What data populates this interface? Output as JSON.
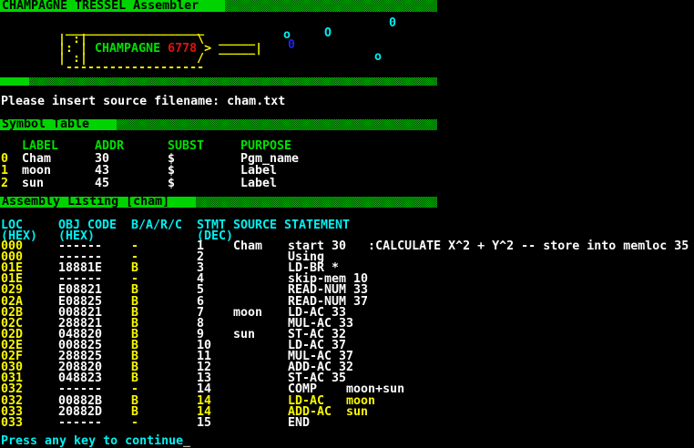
{
  "title_bar": {
    "text": "CHAMPAGNE TRESSEL Assembler"
  },
  "bottle": {
    "top": " ___________________",
    "row2": "| :|               \\  _____",
    "row3_pre": "|: | ",
    "label": "CHAMPAGNE",
    "row3_mid": " ",
    "number": "6778",
    "row3_post": " > _____|",
    "row4": "| :|               /",
    "bottom": " -------------------",
    "bubbles": [
      {
        "glyph": "o",
        "color": "#00f0f0"
      },
      {
        "glyph": "0",
        "color": "#2222e8"
      },
      {
        "glyph": "O",
        "color": "#00f0f0"
      },
      {
        "glyph": "0",
        "color": "#00f0f0"
      },
      {
        "glyph": "o",
        "color": "#00f0f0"
      }
    ]
  },
  "prompt": {
    "text": "Please insert source filename: cham.txt"
  },
  "symbol_table": {
    "bar_label": "Symbol Table",
    "headers": [
      "LABEL",
      "ADDR",
      "SUBST",
      "PURPOSE"
    ],
    "rows": [
      {
        "index": "0",
        "label": "Cham",
        "addr": "30",
        "subst": "$",
        "purpose": "Pgm_name"
      },
      {
        "index": "1",
        "label": "moon",
        "addr": "43",
        "subst": "$",
        "purpose": "Label"
      },
      {
        "index": "2",
        "label": "sun",
        "addr": "45",
        "subst": "$",
        "purpose": "Label"
      }
    ]
  },
  "listing": {
    "bar_label": "Assembly Listing [cham]",
    "headers": {
      "loc": "LOC",
      "obj": "OBJ CODE",
      "barc": "B/A/R/C",
      "stmt": "STMT",
      "source": "SOURCE",
      "statement": "STATEMENT",
      "loc_unit": "(HEX)",
      "obj_unit": "(HEX)",
      "stmt_unit": "(DEC)"
    },
    "rows": [
      {
        "loc": "000",
        "obj": "------",
        "barc": "-",
        "stmt": "1",
        "src": "Cham",
        "st": "start 30   :CALCULATE X^2 + Y^2 -- store into memloc 35"
      },
      {
        "loc": "000",
        "obj": "------",
        "barc": "-",
        "stmt": "2",
        "src": "",
        "st": "Using"
      },
      {
        "loc": "01E",
        "obj": "18881E",
        "barc": "B",
        "stmt": "3",
        "src": "",
        "st": "LD-BR *"
      },
      {
        "loc": "01E",
        "obj": "------",
        "barc": "-",
        "stmt": "4",
        "src": "",
        "st": "skip-mem 10"
      },
      {
        "loc": "029",
        "obj": "E08821",
        "barc": "B",
        "stmt": "5",
        "src": "",
        "st": "READ-NUM 33"
      },
      {
        "loc": "02A",
        "obj": "E08825",
        "barc": "B",
        "stmt": "6",
        "src": "",
        "st": "READ-NUM 37"
      },
      {
        "loc": "02B",
        "obj": "008821",
        "barc": "B",
        "stmt": "7",
        "src": "moon",
        "st": "LD-AC 33"
      },
      {
        "loc": "02C",
        "obj": "288821",
        "barc": "B",
        "stmt": "8",
        "src": "",
        "st": "MUL-AC 33"
      },
      {
        "loc": "02D",
        "obj": "048820",
        "barc": "B",
        "stmt": "9",
        "src": "sun",
        "st": "ST-AC 32"
      },
      {
        "loc": "02E",
        "obj": "008825",
        "barc": "B",
        "stmt": "10",
        "src": "",
        "st": "LD-AC 37"
      },
      {
        "loc": "02F",
        "obj": "288825",
        "barc": "B",
        "stmt": "11",
        "src": "",
        "st": "MUL-AC 37"
      },
      {
        "loc": "030",
        "obj": "208820",
        "barc": "B",
        "stmt": "12",
        "src": "",
        "st": "ADD-AC 32"
      },
      {
        "loc": "031",
        "obj": "048823",
        "barc": "B",
        "stmt": "13",
        "src": "",
        "st": "ST-AC 35"
      },
      {
        "loc": "032",
        "obj": "------",
        "barc": "-",
        "stmt": "14",
        "src": "",
        "st": "COMP    moon+sun"
      },
      {
        "loc": "032",
        "obj": "00882B",
        "barc": "B",
        "stmt": "14",
        "src": "",
        "st": "LD-AC   moon"
      },
      {
        "loc": "033",
        "obj": "20882D",
        "barc": "B",
        "stmt": "14",
        "src": "",
        "st": "ADD-AC  sun"
      },
      {
        "loc": "033",
        "obj": "------",
        "barc": "-",
        "stmt": "15",
        "src": "",
        "st": "END"
      }
    ]
  },
  "footer": {
    "text": "Press any key to continue",
    "cursor": "_"
  },
  "colors": {
    "bar_green": "#00d400",
    "dither_green": "#00bc00",
    "dither_dark": "#014a01",
    "text_white": "#fcfcfc",
    "yellow": "#f8f800",
    "cyan": "#00f0f0",
    "green_text": "#00e000",
    "red": "#e01010",
    "blue": "#2222e8",
    "cursor_gray": "#b4b4b4",
    "background": "#000000"
  }
}
